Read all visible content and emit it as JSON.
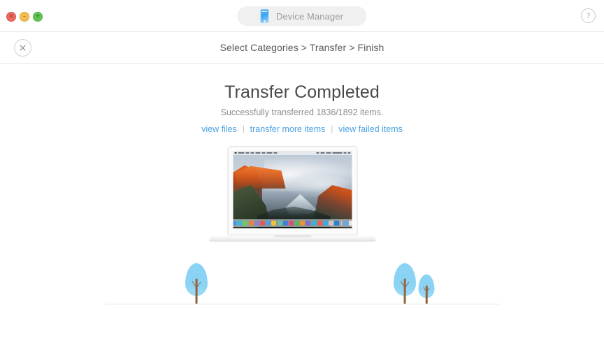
{
  "window": {
    "traffic_lights": [
      {
        "name": "close",
        "glyph": "×",
        "color": "#ec6a5f"
      },
      {
        "name": "minimize",
        "glyph": "–",
        "color": "#f5bd4f"
      },
      {
        "name": "maximize",
        "glyph": "+",
        "color": "#61c555"
      }
    ],
    "device_pill": {
      "icon": "phone-icon",
      "label": "Device Manager"
    },
    "help_button": {
      "icon": "question-mark-icon",
      "glyph": "?"
    }
  },
  "breadcrumb": {
    "close_icon": "close-x-icon",
    "text": "Select Categories > Transfer > Finish",
    "steps": [
      "Select Categories",
      "Transfer",
      "Finish"
    ],
    "separator": ">"
  },
  "main": {
    "headline": "Transfer Completed",
    "subline": "Successfully transferred 1836/1892 items.",
    "transferred_count": "1836",
    "total_count": "1892",
    "links": [
      {
        "label": "view files"
      },
      {
        "label": "transfer more items"
      },
      {
        "label": "view failed items"
      }
    ],
    "link_separator": "|"
  },
  "illustration": {
    "laptop": {
      "name": "macbook-illustration",
      "screen_wallpaper": "el-capitan-mountain-sunset",
      "dock_colors": [
        "#4a8fe0",
        "#3fb6d6",
        "#6fc96a",
        "#e6863b",
        "#8f7fd0",
        "#e05a5a",
        "#4f9ae8",
        "#f0c33c",
        "#5fc1a8",
        "#3f7fd8",
        "#d94f7a",
        "#58b85a",
        "#e8952f",
        "#7b6fc8",
        "#34b4e0",
        "#f25d4a",
        "#46a6de",
        "#c8c8c8",
        "#2f7fd0"
      ],
      "dock_trailing_colors": [
        "#6aa8e0",
        "#e8e8e8"
      ]
    },
    "trees": [
      {
        "name": "tree-left",
        "size": "medium"
      },
      {
        "name": "tree-right-large",
        "size": "large"
      },
      {
        "name": "tree-right-small",
        "size": "small"
      }
    ],
    "ground_line": true
  },
  "colors": {
    "link": "#4ba3e3",
    "heading": "#4a4a4a",
    "subtext": "#8d8d8d",
    "background": "#ffffff",
    "tree_crown": "#8ad3f4",
    "tree_trunk": "#8e6038"
  }
}
